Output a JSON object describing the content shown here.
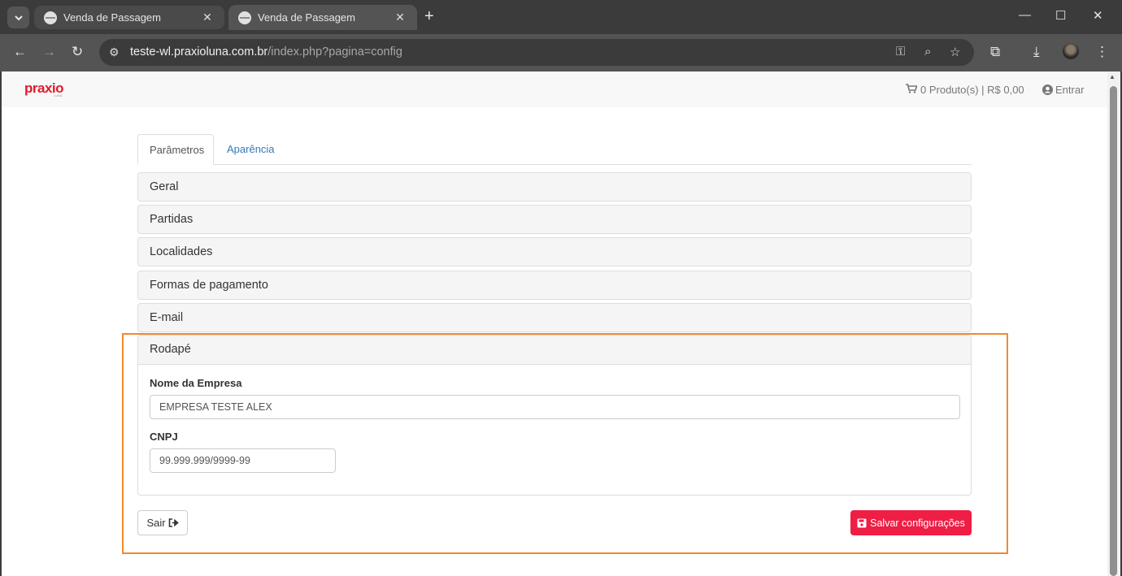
{
  "browser": {
    "tabs": [
      {
        "title": "Venda de Passagem",
        "close": "✕"
      },
      {
        "title": "Venda de Passagem",
        "close": "✕"
      }
    ],
    "new_tab": "+",
    "window_controls": {
      "minimize": "—",
      "maximize": "☐",
      "close": "✕"
    },
    "url_host": "teste-wl.praxioluna.com.br",
    "url_path": "/index.php?pagina=config",
    "icons": [
      "tab-search-icon",
      "back-icon",
      "forward-icon",
      "reload-icon",
      "site-info-icon",
      "key-icon",
      "zoom-icon",
      "star-icon",
      "extensions-icon",
      "download-icon",
      "profile-avatar",
      "menu-icon"
    ]
  },
  "header": {
    "logo": "praxio",
    "logo_sub": "LUNA",
    "cart": "0 Produto(s) | R$ 0,00",
    "login": "Entrar"
  },
  "tabs": {
    "parametros": "Parâmetros",
    "aparencia": "Aparência"
  },
  "sections": [
    {
      "title": "Geral"
    },
    {
      "title": "Partidas"
    },
    {
      "title": "Localidades"
    },
    {
      "title": "Formas de pagamento"
    },
    {
      "title": "E-mail"
    }
  ],
  "rodape": {
    "title": "Rodapé",
    "nome_label": "Nome da Empresa",
    "nome_value": "EMPRESA TESTE ALEX",
    "cnpj_label": "CNPJ",
    "cnpj_value": "99.999.999/9999-99"
  },
  "actions": {
    "sair": "Sair",
    "salvar": "Salvar configurações"
  },
  "colors": {
    "brand": "#e2192c",
    "save_button": "#ee1e45",
    "link": "#337ab7",
    "highlight": "#f28a2b"
  }
}
